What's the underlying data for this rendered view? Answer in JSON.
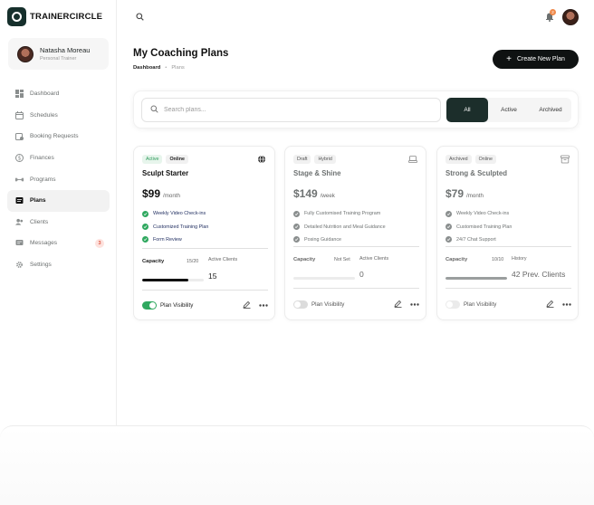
{
  "app": {
    "name": "TRAINERCIRCLE"
  },
  "profile": {
    "name": "Natasha Moreau",
    "role": "Personal Trainer"
  },
  "nav": [
    {
      "label": "Dashboard",
      "icon": "dashboard-icon"
    },
    {
      "label": "Schedules",
      "icon": "calendar-icon"
    },
    {
      "label": "Booking Requests",
      "icon": "booking-icon"
    },
    {
      "label": "Finances",
      "icon": "dollar-icon"
    },
    {
      "label": "Programs",
      "icon": "dumbbell-icon"
    },
    {
      "label": "Plans",
      "icon": "plans-icon",
      "active": true
    },
    {
      "label": "Clients",
      "icon": "users-icon"
    },
    {
      "label": "Messages",
      "icon": "message-icon",
      "badge": "3"
    },
    {
      "label": "Settings",
      "icon": "gear-icon"
    }
  ],
  "topbar": {
    "notifications": "2"
  },
  "page": {
    "title": "My Coaching Plans",
    "breadcrumb": [
      "Dashboard",
      "Plans"
    ],
    "create_label": "Create New Plan"
  },
  "filter": {
    "search_placeholder": "Search plans...",
    "tabs": [
      "All",
      "Active",
      "Archived"
    ],
    "selected": "All"
  },
  "plans": [
    {
      "tags": [
        "Active",
        "Online"
      ],
      "title": "Sculpt Starter",
      "price": "$99",
      "period": "/month",
      "features": [
        "Weekly Video Check-ins",
        "Customized Training Plan",
        "Form Review"
      ],
      "capacity_label": "Capacity",
      "capacity_value": "15/20",
      "capacity_fraction": 0.75,
      "stat_label": "Active Clients",
      "stat_value": "15",
      "visibility_label": "Plan Visibility",
      "visible": true
    },
    {
      "tags": [
        "Draft",
        "Hybrid"
      ],
      "title": "Stage & Shine",
      "price": "$149",
      "period": "/week",
      "features": [
        "Fully Customised Training Program",
        "Detailed Nutrition and Meal Guidance",
        "Posing Guidance"
      ],
      "capacity_label": "Capacity",
      "capacity_value": "Not Set",
      "capacity_fraction": 0,
      "stat_label": "Active Clients",
      "stat_value": "0",
      "visibility_label": "Plan Visibility",
      "visible": false
    },
    {
      "tags": [
        "Archived",
        "Online"
      ],
      "title": "Strong & Sculpted",
      "price": "$79",
      "period": "/month",
      "features": [
        "Weekly Video Check-ins",
        "Customised Training Plan",
        "24/7 Chat Support"
      ],
      "capacity_label": "Capacity",
      "capacity_value": "10/10",
      "capacity_fraction": 1.0,
      "stat_label": "History",
      "stat_value": "42 Prev. Clients",
      "visibility_label": "Plan Visibility",
      "visible": false
    }
  ],
  "colors": {
    "accent": "#1c2e2b",
    "success": "#2fa85f",
    "badge": "#e05a45"
  }
}
